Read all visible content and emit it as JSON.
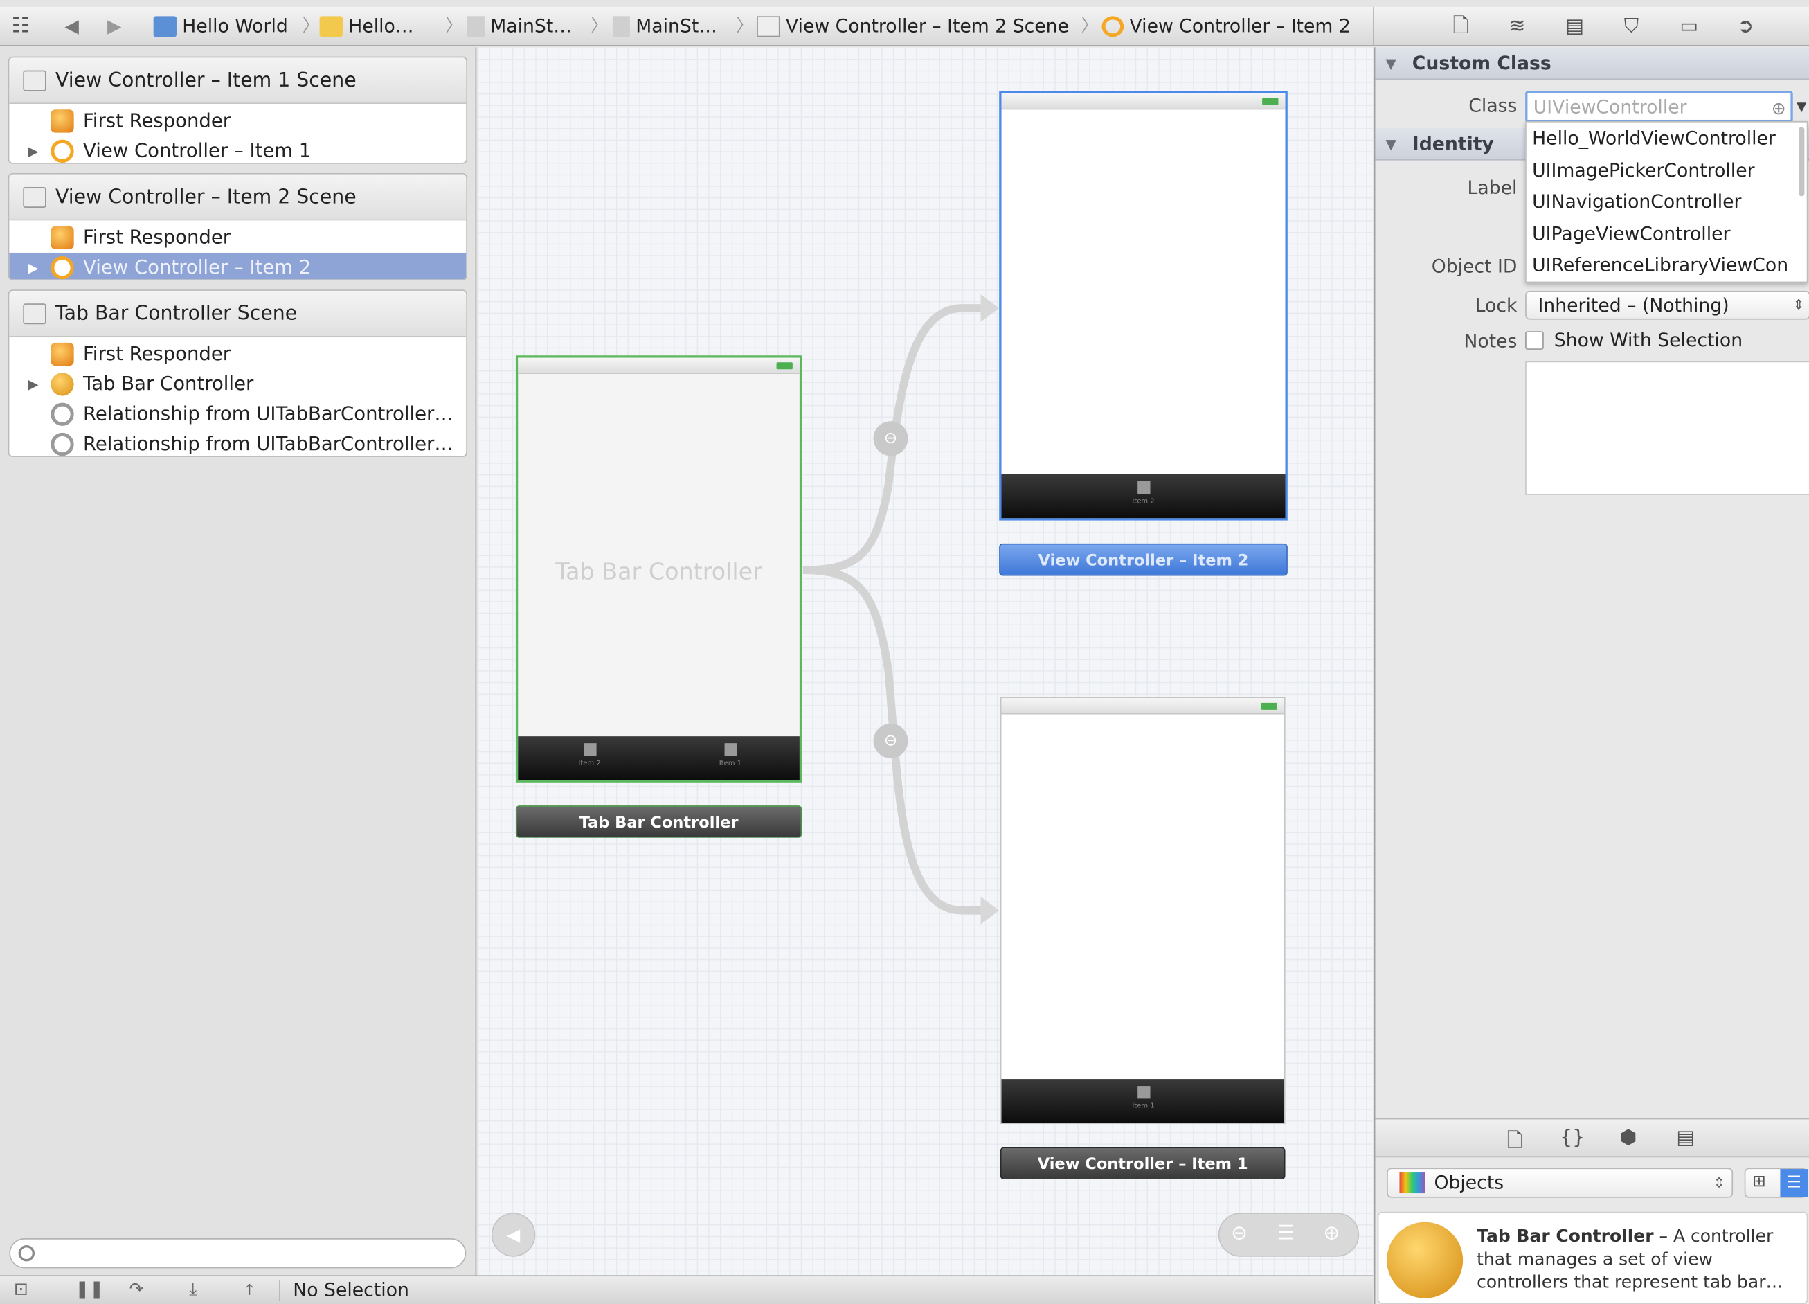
{
  "jumpbar": {
    "crumbs": [
      "Hello World",
      "Hello…",
      "MainSt…",
      "MainSt…",
      "View Controller – Item 2 Scene",
      "View Controller – Item 2"
    ]
  },
  "outline": {
    "scenes": [
      {
        "title": "View Controller – Item 1 Scene",
        "items": [
          "First Responder",
          "View Controller – Item 1"
        ]
      },
      {
        "title": "View Controller – Item 2 Scene",
        "items": [
          "First Responder",
          "View Controller – Item 2"
        ]
      },
      {
        "title": "Tab Bar Controller Scene",
        "items": [
          "First Responder",
          "Tab Bar Controller",
          "Relationship from UITabBarController…",
          "Relationship from UITabBarController…"
        ]
      }
    ]
  },
  "canvas": {
    "tab_bar_controller": {
      "body_label": "Tab Bar Controller",
      "title": "Tab Bar Controller",
      "tab_items": [
        "Item 2",
        "Item 1"
      ]
    },
    "vc_item2": {
      "title": "View Controller – Item 2",
      "tab_item": "Item 2"
    },
    "vc_item1": {
      "title": "View Controller – Item 1",
      "tab_item": "Item 1"
    }
  },
  "inspector": {
    "custom_class": {
      "header": "Custom Class",
      "class_label": "Class",
      "class_placeholder": "UIViewController",
      "suggestions": [
        "Hello_WorldViewController",
        "UIImagePickerController",
        "UINavigationController",
        "UIPageViewController",
        "UIReferenceLibraryViewCon"
      ]
    },
    "identity": {
      "header": "Identity",
      "label_label": "Label",
      "object_id_label": "Object ID",
      "lock_label": "Lock",
      "lock_value": "Inherited – (Nothing)",
      "notes_label": "Notes",
      "notes_checkbox": "Show With Selection"
    },
    "library": {
      "popup": "Objects",
      "entry_title": "Tab Bar Controller",
      "entry_desc": " – A controller that manages a set of view controllers that represent tab bar…"
    }
  },
  "debug": {
    "status": "No Selection"
  },
  "colors": {
    "selection": "#8ea3d6",
    "accent_blue": "#3f78d8",
    "tbc_outline": "#4caf50"
  }
}
